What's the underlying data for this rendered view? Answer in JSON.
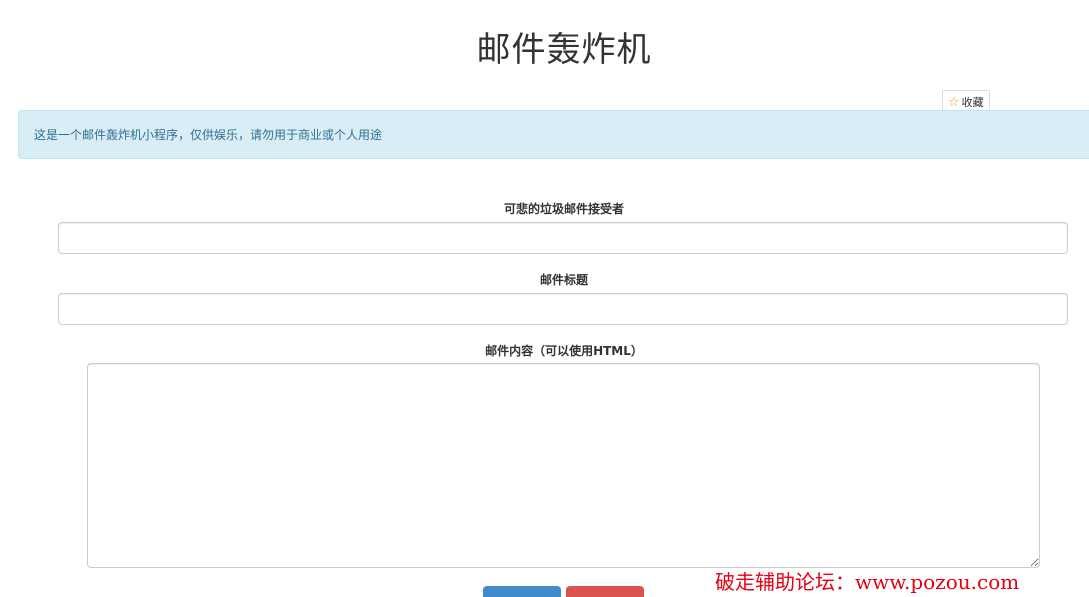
{
  "page": {
    "title": "邮件轰炸机"
  },
  "favorite": {
    "icon": "star-icon",
    "label": "收藏"
  },
  "alert": {
    "text": "这是一个邮件轰炸机小程序，仅供娱乐，请勿用于商业或个人用途"
  },
  "form": {
    "recipient_label": "可悲的垃圾邮件接受者",
    "recipient_value": "",
    "subject_label": "邮件标题",
    "subject_value": "",
    "content_label": "邮件内容（可以使用HTML）",
    "content_value": ""
  },
  "buttons": {
    "submit_label": "",
    "reset_label": ""
  },
  "watermark": {
    "text": "破走辅助论坛：www.pozou.com"
  },
  "colors": {
    "alert_bg": "#d9edf7",
    "alert_text": "#31708f",
    "primary": "#428bca",
    "danger": "#d9534f",
    "watermark": "#e60012"
  }
}
